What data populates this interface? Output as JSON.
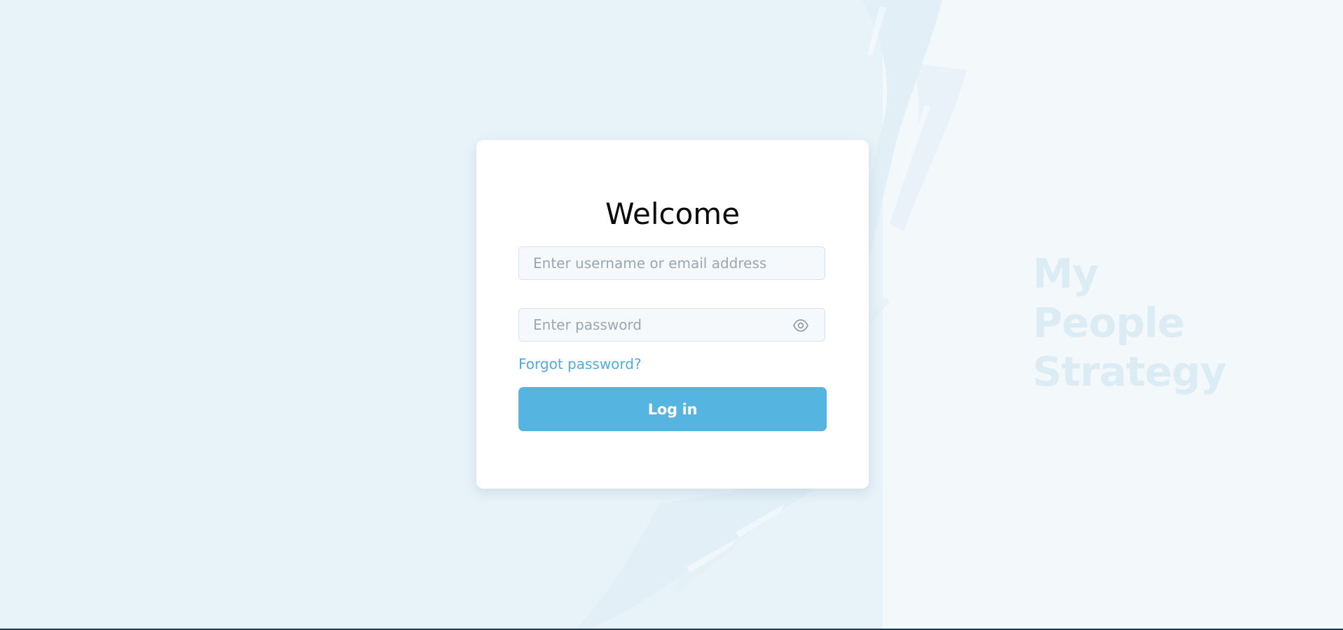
{
  "login": {
    "title": "Welcome",
    "username_placeholder": "Enter username or email address",
    "password_placeholder": "Enter password",
    "forgot_label": "Forgot password?",
    "login_label": "Log in",
    "show_password_icon": "eye-icon"
  },
  "brand": {
    "line1": "My",
    "line2": "People",
    "line3": "Strategy"
  },
  "colors": {
    "background": "#e8f3f9",
    "accent": "#56b4e0",
    "link": "#4aaed8",
    "brand_text": "#dcecf5"
  }
}
